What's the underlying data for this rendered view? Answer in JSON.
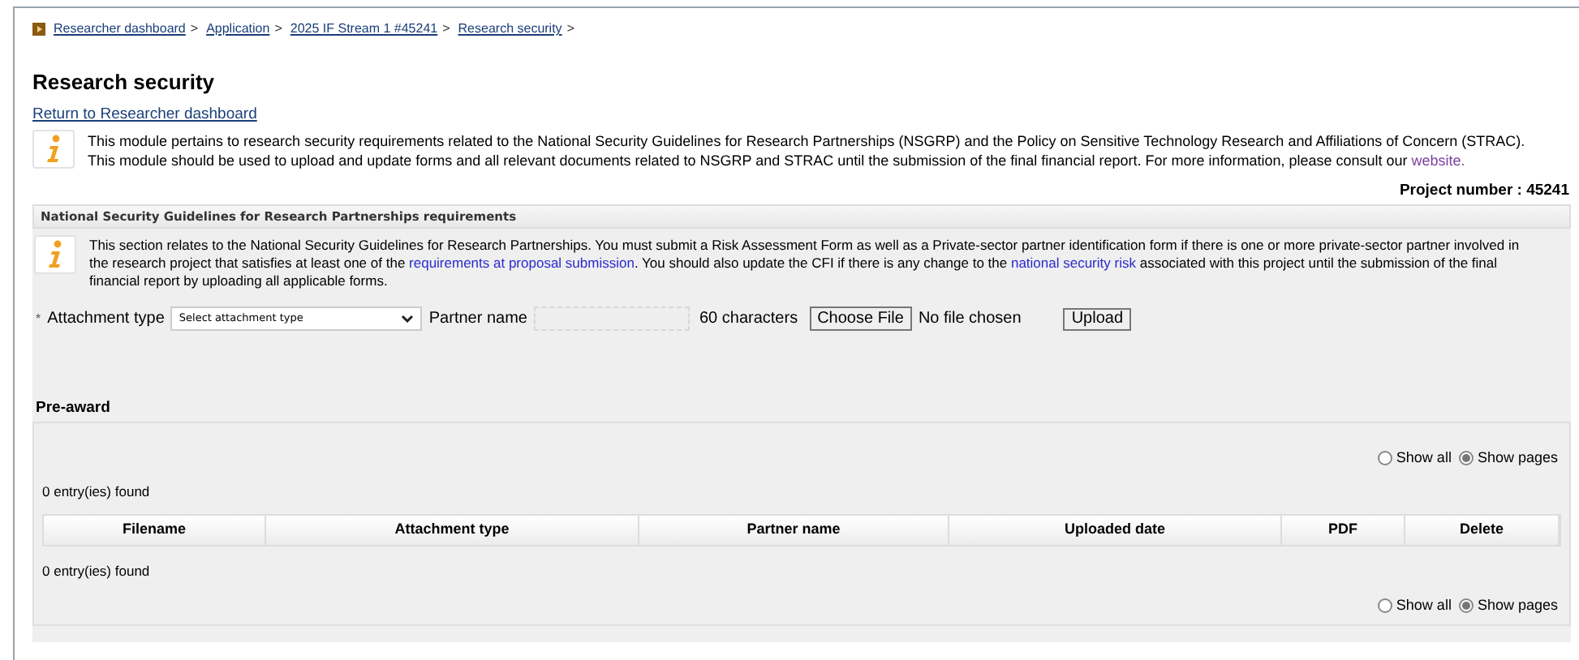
{
  "breadcrumb": [
    {
      "label": "Researcher dashboard"
    },
    {
      "label": "Application"
    },
    {
      "label": "2025 IF Stream 1 #45241"
    },
    {
      "label": "Research security"
    }
  ],
  "breadcrumb_separator": ">",
  "title": "Research security",
  "return_link": "Return to Researcher dashboard",
  "intro": [
    {
      "text": "This module pertains to research security requirements related to the National Security Guidelines for Research Partnerships (NSGRP) and the Policy on Sensitive Technology Research and Affiliations of Concern (STRAC). This module should be used to upload and update forms and all relevant documents related to NSGRP and STRAC until the submission of the final financial report. For more information, please consult our ",
      "kind": "text"
    },
    {
      "text": "website.",
      "kind": "link"
    }
  ],
  "project_number": "Project number : 45241",
  "section": {
    "title": "National Security Guidelines for Research Partnerships requirements",
    "info": [
      {
        "text": "This section relates to the National Security Guidelines for Research Partnerships. You must submit a Risk Assessment Form as well as a Private-sector partner identification form if there is one or more private-sector partner involved in the research project that satisfies at least one of the ",
        "kind": "text"
      },
      {
        "text": "requirements at proposal submission",
        "kind": "link"
      },
      {
        "text": ". You should also update the CFI if there is any change to the ",
        "kind": "text"
      },
      {
        "text": "national security risk",
        "kind": "link"
      },
      {
        "text": " associated with this project until the submission of the final financial report by uploading all applicable forms.",
        "kind": "text"
      }
    ],
    "form": {
      "required_mark": "*",
      "attachment_label": "Attachment type",
      "attachment_value": "Select attachment type",
      "partner_label": "Partner name",
      "partner_hint": "60 characters",
      "choose_file": "Choose File",
      "file_status": "No file chosen",
      "upload": "Upload"
    }
  },
  "pre_award": {
    "title": "Pre-award",
    "radios_top": [
      {
        "label": "Show all",
        "selected": false
      },
      {
        "label": "Show pages",
        "selected": true
      }
    ],
    "count_top": "0 entry(ies) found",
    "columns": [
      "Filename",
      "Attachment type",
      "Partner name",
      "Uploaded date",
      "PDF",
      "Delete"
    ],
    "count_bottom": "0 entry(ies) found",
    "radios_bottom": [
      {
        "label": "Show all",
        "selected": false
      },
      {
        "label": "Show pages",
        "selected": true
      }
    ]
  }
}
